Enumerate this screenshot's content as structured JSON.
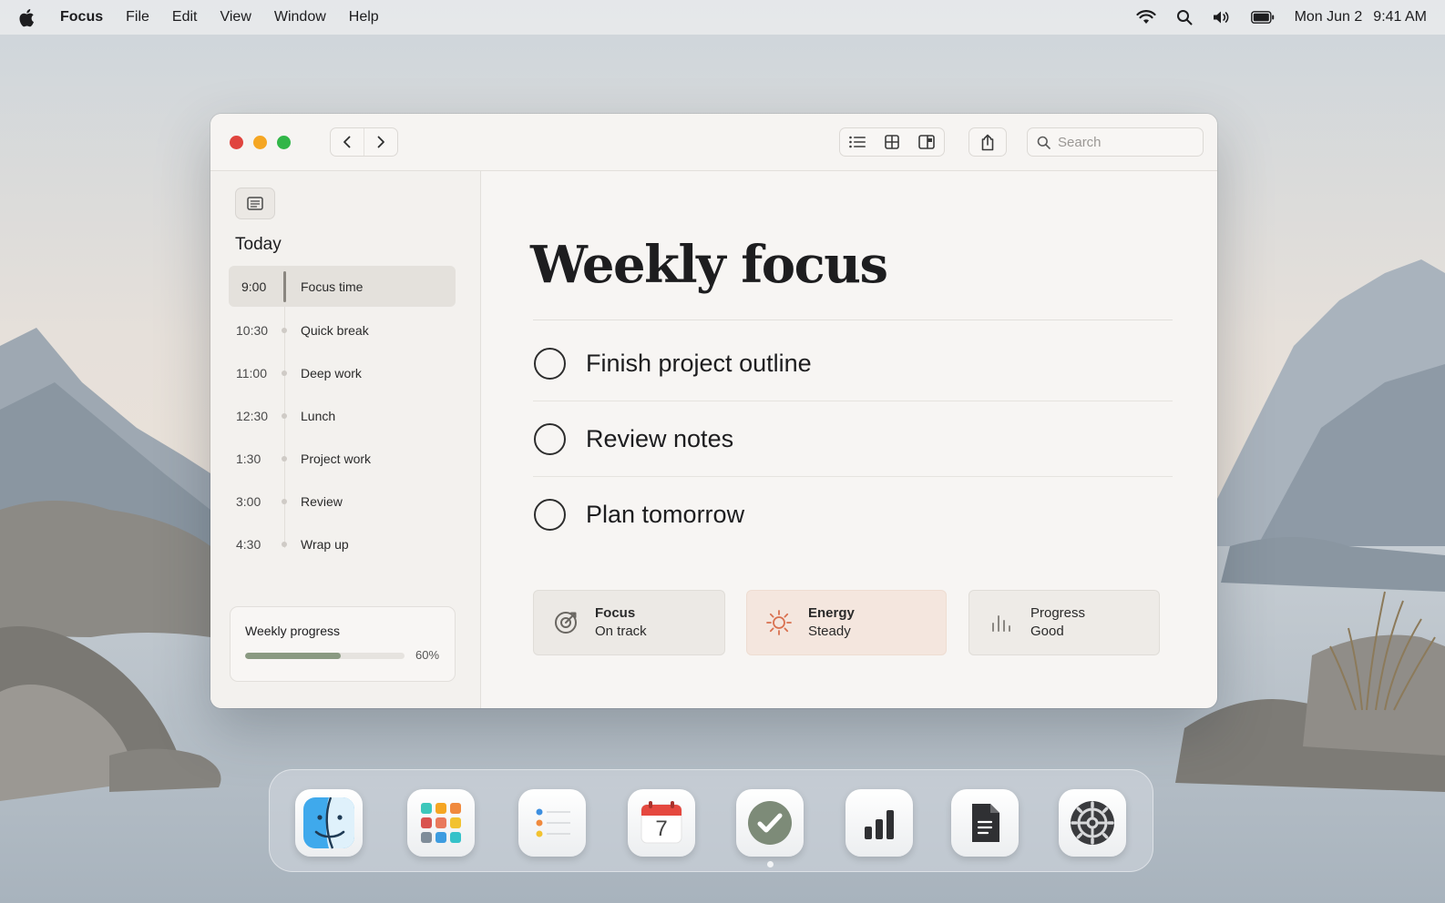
{
  "menubar": {
    "app_name": "Focus",
    "menus": [
      "File",
      "Edit",
      "View",
      "Window",
      "Help"
    ],
    "date": "Mon Jun 2",
    "time": "9:41 AM"
  },
  "toolbar": {
    "search_placeholder": "Search"
  },
  "sidebar": {
    "section_title": "Today",
    "schedule": [
      {
        "time": "9:00",
        "label": "Focus time",
        "active": true
      },
      {
        "time": "10:30",
        "label": "Quick break",
        "active": false
      },
      {
        "time": "11:00",
        "label": "Deep work",
        "active": false
      },
      {
        "time": "12:30",
        "label": "Lunch",
        "active": false
      },
      {
        "time": "1:30",
        "label": "Project work",
        "active": false
      },
      {
        "time": "3:00",
        "label": "Review",
        "active": false
      },
      {
        "time": "4:30",
        "label": "Wrap up",
        "active": false
      }
    ],
    "progress": {
      "title": "Weekly progress",
      "value_label": "60%",
      "value": 0.6
    }
  },
  "main": {
    "title": "Weekly focus",
    "tasks": [
      {
        "label": "Finish project outline",
        "done": false
      },
      {
        "label": "Review notes",
        "done": false
      },
      {
        "label": "Plan tomorrow",
        "done": false
      }
    ],
    "stats": [
      {
        "label": "Focus",
        "value": "On track",
        "icon": "target-icon"
      },
      {
        "label": "Energy",
        "value": "Steady",
        "icon": "sun-icon"
      },
      {
        "label": "Progress",
        "value": "Good",
        "icon": "bar-chart-icon"
      }
    ]
  },
  "dock": {
    "apps": [
      "finder-icon",
      "launchpad-icon",
      "reminders-icon",
      "calendar-icon",
      "focus-app-icon",
      "numbers-icon",
      "pages-icon",
      "settings-icon"
    ],
    "calendar_day": "7",
    "running_app": "focus-app-icon"
  },
  "colors": {
    "close": "#e0443e",
    "minimize": "#f5a623",
    "maximize": "#31b648",
    "progress_fill": "#8a9a82",
    "energy_accent": "#d9704f"
  }
}
